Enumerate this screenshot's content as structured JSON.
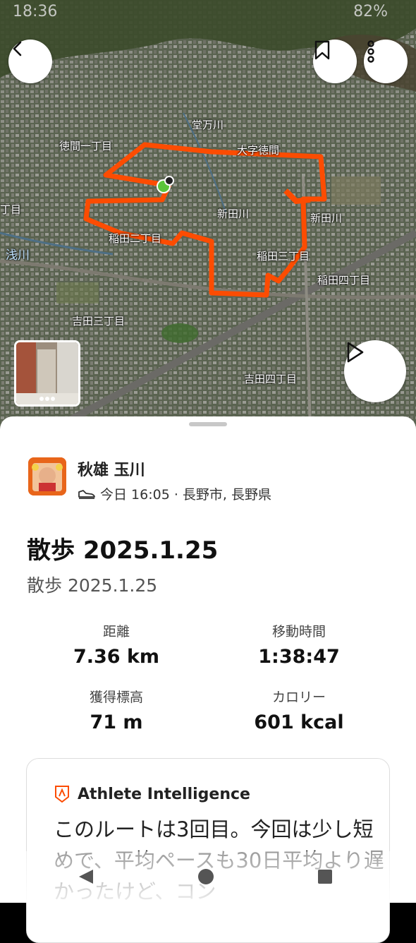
{
  "status_bar": {
    "time": "18:36",
    "battery": "82%"
  },
  "map": {
    "labels": [
      {
        "id": "tokuma1",
        "text": "徳間一丁目"
      },
      {
        "id": "oaza-tokuma",
        "text": "大字徳間"
      },
      {
        "id": "dobuman",
        "text": "堂万川"
      },
      {
        "id": "shinden1",
        "text": "新田川"
      },
      {
        "id": "shinden2",
        "text": "新田川"
      },
      {
        "id": "inada2",
        "text": "稲田二丁目"
      },
      {
        "id": "inada3",
        "text": "稲田三丁目"
      },
      {
        "id": "inada4",
        "text": "稲田四丁目"
      },
      {
        "id": "yoshida3",
        "text": "吉田三丁目"
      },
      {
        "id": "yoshida4",
        "text": "吉田四丁目"
      },
      {
        "id": "asakawa",
        "text": "浅川"
      },
      {
        "id": "chome-left",
        "text": "丁目"
      }
    ],
    "route_color": "#fc4c02",
    "start_color": "#5ac53a",
    "back_icon": "chevron-left-icon",
    "bookmark_icon": "bookmark-icon",
    "more_icon": "more-vertical-icon",
    "play_icon": "play-icon"
  },
  "athlete": {
    "name": "秋雄 玉川",
    "meta": "今日 16:05 · 長野市, 長野県",
    "activity_icon": "shoe-icon"
  },
  "activity": {
    "title": "散歩 2025.1.25",
    "description": "散歩 2025.1.25"
  },
  "stats": [
    {
      "label": "距離",
      "value": "7.36 km"
    },
    {
      "label": "移動時間",
      "value": "1:38:47"
    },
    {
      "label": "獲得標高",
      "value": "71 m"
    },
    {
      "label": "カロリー",
      "value": "601 kcal"
    }
  ],
  "athlete_intelligence": {
    "title": "Athlete Intelligence",
    "text": "このルートは3回目。今回は少し短めで、平均ペースも30日平均より遅かったけど、コン"
  },
  "colors": {
    "accent": "#fc4c02"
  }
}
